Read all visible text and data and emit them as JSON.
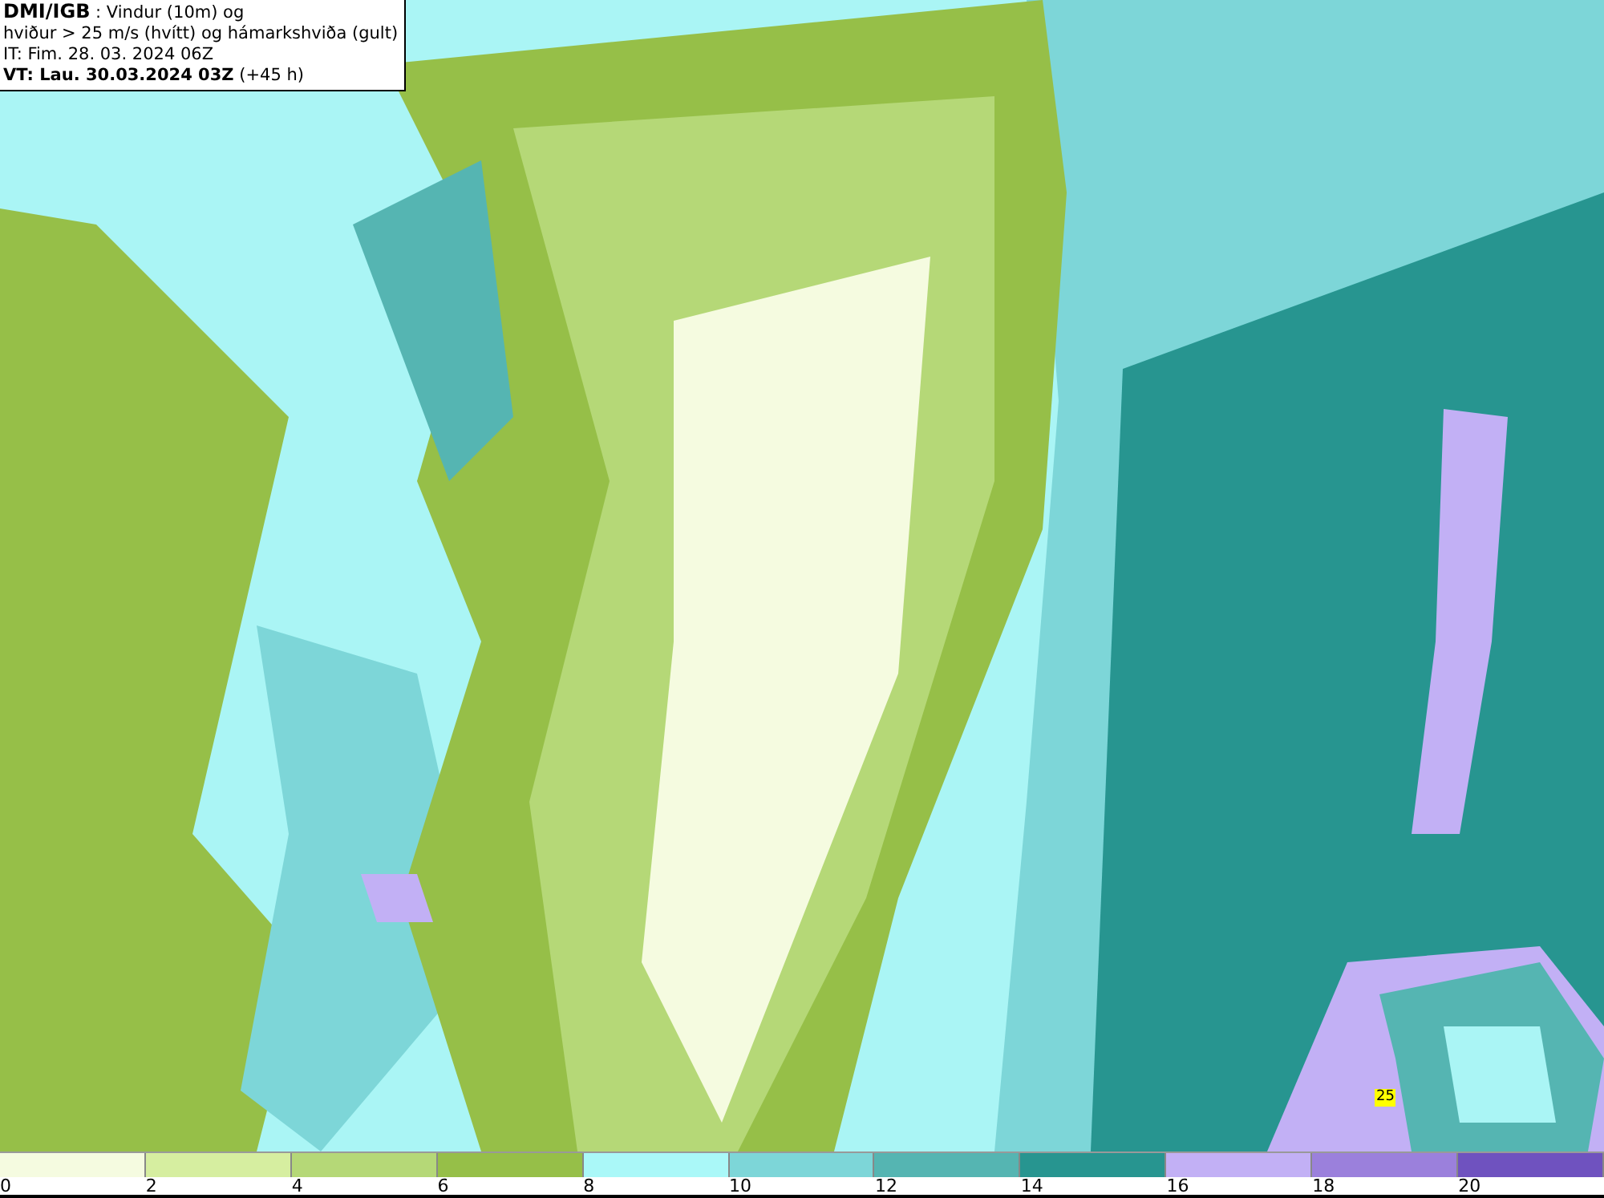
{
  "header": {
    "source": "DMI/IGB",
    "title_rest": " : Vindur (10m) og",
    "line_2": "hviður > 25 m/s (hvítt) og hámarkshviða (gult)",
    "line_3": "IT: Fim. 28. 03. 2024 06Z",
    "valid_time": "VT: Lau. 30.03.2024 03Z",
    "lead": " (+45 h)"
  },
  "map": {
    "marker": "25"
  },
  "legend": {
    "bins": [
      {
        "color": "#f5fbe0"
      },
      {
        "color": "#d6eea0"
      },
      {
        "color": "#b5d877"
      },
      {
        "color": "#96bf48"
      },
      {
        "color": "#aaf8f8"
      },
      {
        "color": "#7dd6d8"
      },
      {
        "color": "#55b5b2"
      },
      {
        "color": "#279590"
      },
      {
        "color": "#c2b0f5"
      },
      {
        "color": "#9b80dc"
      },
      {
        "color": "#6f52bf"
      }
    ],
    "ticks": [
      "0",
      "2",
      "4",
      "6",
      "8",
      "10",
      "12",
      "14",
      "16",
      "18",
      "20"
    ]
  }
}
